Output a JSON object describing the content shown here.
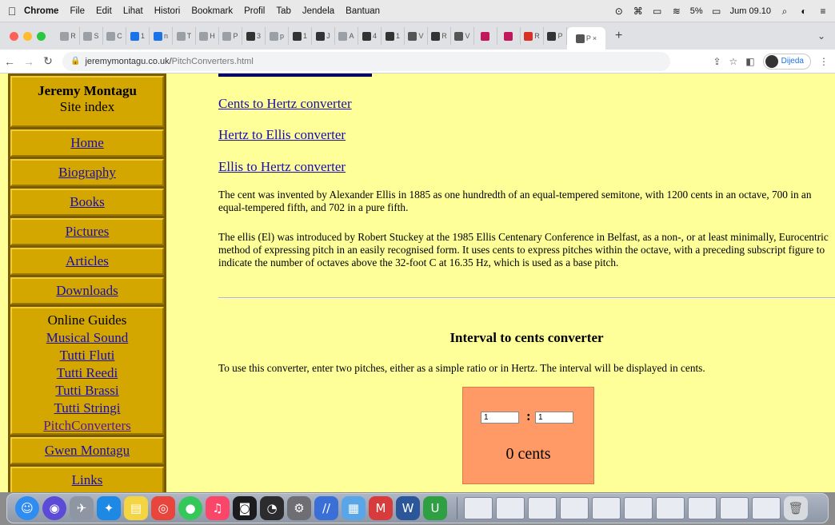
{
  "menubar": {
    "app": "Chrome",
    "items": [
      "File",
      "Edit",
      "Lihat",
      "Histori",
      "Bookmark",
      "Profil",
      "Tab",
      "Jendela",
      "Bantuan"
    ],
    "battery": "5%",
    "clock": "Jum 09.10"
  },
  "tabs": {
    "items": [
      {
        "letter": "R",
        "color": "#9aa0a6"
      },
      {
        "letter": "S",
        "color": "#9aa0a6"
      },
      {
        "letter": "C",
        "color": "#9aa0a6"
      },
      {
        "letter": "1",
        "color": "#1a73e8"
      },
      {
        "letter": "n",
        "color": "#1a73e8"
      },
      {
        "letter": "T",
        "color": "#9aa0a6"
      },
      {
        "letter": "H",
        "color": "#9aa0a6"
      },
      {
        "letter": "P",
        "color": "#9aa0a6"
      },
      {
        "letter": "3",
        "color": "#333333"
      },
      {
        "letter": "p",
        "color": "#9aa0a6"
      },
      {
        "letter": "1",
        "color": "#333333"
      },
      {
        "letter": "J",
        "color": "#333333"
      },
      {
        "letter": "A",
        "color": "#9aa0a6"
      },
      {
        "letter": "4",
        "color": "#333333"
      },
      {
        "letter": "1",
        "color": "#333333"
      },
      {
        "letter": "V",
        "color": "#555555"
      },
      {
        "letter": "R",
        "color": "#333333"
      },
      {
        "letter": "V",
        "color": "#555555"
      },
      {
        "letter": "",
        "color": "#c2185b"
      },
      {
        "letter": "",
        "color": "#c2185b"
      },
      {
        "letter": "R",
        "color": "#d93025"
      },
      {
        "letter": "P",
        "color": "#333333"
      }
    ],
    "active": {
      "letter": "P",
      "close": "×"
    },
    "new_tab": "+",
    "menu": "⌄"
  },
  "toolbar": {
    "url_host": "jeremymontagu.co.uk/",
    "url_path": "PitchConverters.html",
    "profile_label": "Dijeda"
  },
  "sidebar": {
    "title": "Jeremy Montagu",
    "subtitle": "Site index",
    "nav": [
      {
        "label": "Home"
      },
      {
        "label": "Biography"
      },
      {
        "label": "Books"
      },
      {
        "label": "Pictures"
      },
      {
        "label": "Articles"
      },
      {
        "label": "Downloads"
      }
    ],
    "guides_heading": "Online Guides",
    "guides": [
      {
        "label": "Musical Sound"
      },
      {
        "label": "Tutti Fluti"
      },
      {
        "label": "Tutti Reedi"
      },
      {
        "label": "Tutti Brassi"
      },
      {
        "label": "Tutti Stringi"
      },
      {
        "label": "PitchConverters"
      }
    ],
    "extra": [
      {
        "label": "Gwen Montagu"
      },
      {
        "label": "Links"
      }
    ]
  },
  "content": {
    "links": [
      {
        "label": "Cents to Hertz converter"
      },
      {
        "label": "Hertz to Ellis converter"
      },
      {
        "label": "Ellis to Hertz converter"
      }
    ],
    "para1": "The cent was invented by Alexander Ellis in 1885 as one hundredth of an equal-tempered semitone, with 1200 cents in an octave, 700 in an equal-tempered fifth, and 702 in a pure fifth.",
    "para2": "The ellis (El) was introduced by Robert Stuckey at the 1985 Ellis Centenary Conference in Belfast, as a non-, or at least minimally, Eurocentric method of expressing pitch in an easily recognised form. It uses cents to express pitches within the octave, with a preceding subscript figure to indicate the number of octaves above the 32-foot C at 16.35 Hz, which is used as a base pitch.",
    "heading": "Interval to cents converter",
    "instructions": "To use this converter, enter two pitches, either as a simple ratio or in Hertz. The interval will be displayed in cents.",
    "converter": {
      "pitch1": "1",
      "separator": ":",
      "pitch2": "1",
      "result": "0 cents"
    }
  },
  "dock": {
    "apps": [
      {
        "name": "finder-icon",
        "color": "#2f8cf0",
        "glyph": "☺"
      },
      {
        "name": "siri-icon",
        "color": "#5b4bd6",
        "glyph": "◉"
      },
      {
        "name": "launchpad-icon",
        "color": "#8e96a3",
        "glyph": "✈"
      },
      {
        "name": "safari-icon",
        "color": "#1e88e5",
        "glyph": "✦"
      },
      {
        "name": "notes-icon",
        "color": "#f5d442",
        "glyph": "▤"
      },
      {
        "name": "chrome-icon",
        "color": "#e8453c",
        "glyph": "◎"
      },
      {
        "name": "messages-icon",
        "color": "#34c759",
        "glyph": "●"
      },
      {
        "name": "music-icon",
        "color": "#fa4668",
        "glyph": "♫"
      },
      {
        "name": "podcasts-icon",
        "color": "#1c1c1e",
        "glyph": "◙"
      },
      {
        "name": "camera-icon",
        "color": "#2c2c2e",
        "glyph": "◔"
      },
      {
        "name": "settings-icon",
        "color": "#6e6e73",
        "glyph": "⚙"
      },
      {
        "name": "editor-icon",
        "color": "#3a6fd8",
        "glyph": "∕∕"
      },
      {
        "name": "preview-icon",
        "color": "#58a6e8",
        "glyph": "▦"
      },
      {
        "name": "office-icon",
        "color": "#d83b3b",
        "glyph": "M"
      },
      {
        "name": "word-icon",
        "color": "#2b579a",
        "glyph": "W"
      },
      {
        "name": "torrent-icon",
        "color": "#2ea043",
        "glyph": "U"
      }
    ],
    "thumbnails": 10,
    "trash": "trash-icon"
  }
}
